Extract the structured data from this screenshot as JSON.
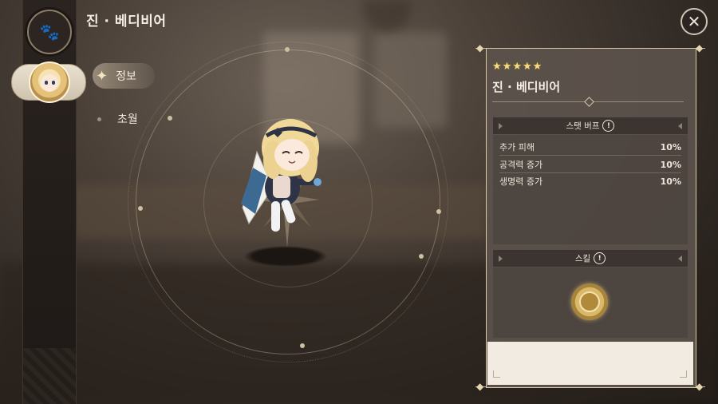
{
  "header": {
    "title": "진 · 베디비어",
    "menu_icon": "paw-icon",
    "close_icon": "close-icon",
    "close_glyph": "✕"
  },
  "nav": {
    "items": [
      {
        "label": "정보",
        "icon": "sparkle-icon",
        "active": true
      },
      {
        "label": "초월",
        "icon": "dot-icon",
        "active": false
      }
    ]
  },
  "character": {
    "name": "진 · 베디비어",
    "stars": [
      "★",
      "★",
      "★",
      "★",
      "★"
    ]
  },
  "stat_buff": {
    "header": "스탯 버프",
    "info_glyph": "!",
    "rows": [
      {
        "label": "추가 피해",
        "value": "10%"
      },
      {
        "label": "공격력 증가",
        "value": "10%"
      },
      {
        "label": "생명력 증가",
        "value": "10%"
      }
    ]
  },
  "skill": {
    "header": "스킬",
    "info_glyph": "!",
    "icon": "skill-emblem-icon"
  },
  "colors": {
    "accent_gold": "#f4dc85",
    "panel_bg": "#5c524c",
    "section_header": "#3b3431"
  }
}
